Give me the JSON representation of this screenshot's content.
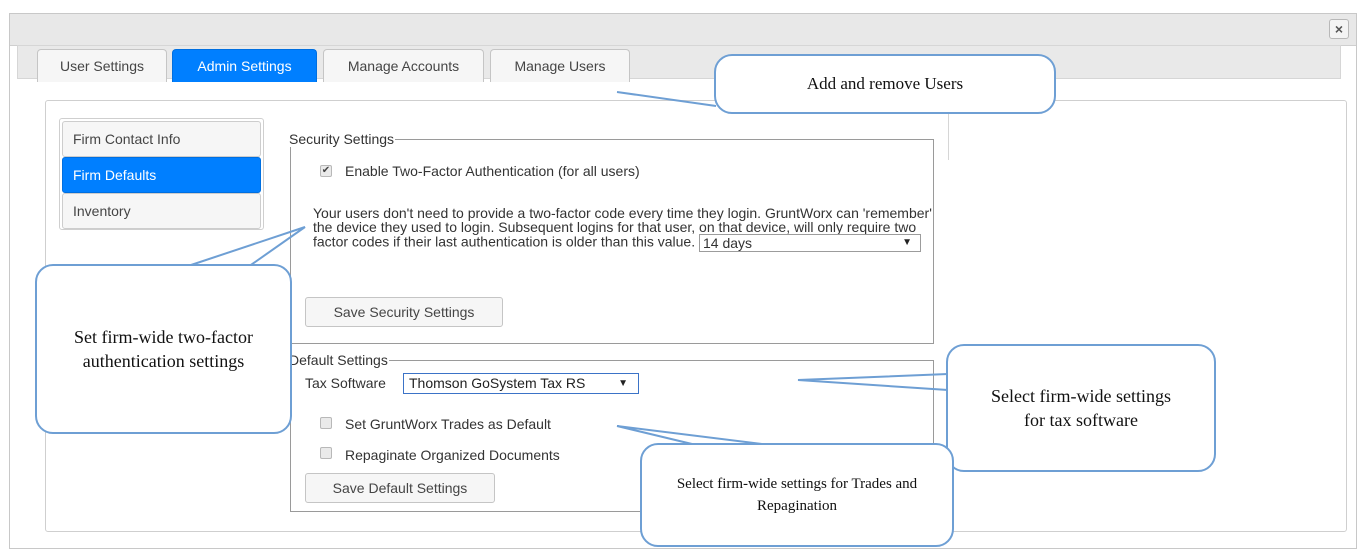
{
  "dialog": {
    "close_symbol": "×"
  },
  "tabs": [
    {
      "label": "User Settings"
    },
    {
      "label": "Admin Settings"
    },
    {
      "label": "Manage Accounts"
    },
    {
      "label": "Manage Users"
    }
  ],
  "sidebar": {
    "items": [
      {
        "label": "Firm Contact Info"
      },
      {
        "label": "Firm Defaults"
      },
      {
        "label": "Inventory"
      }
    ]
  },
  "security": {
    "legend": "Security Settings",
    "two_factor_label": "Enable Two-Factor Authentication (for all users)",
    "two_factor_checked": true,
    "description": "Your users don't need to provide a two-factor code every time they login. GruntWorx can 'remember' the device they used to login. Subsequent logins for that user, on that device, will only require two factor codes if their last authentication is older than this value.",
    "remember_value": "14 days",
    "save_label": "Save Security Settings"
  },
  "defaults": {
    "legend": "Default Settings",
    "tax_software_label": "Tax Software",
    "tax_software_value": "Thomson GoSystem Tax RS",
    "trades_label": "Set GruntWorx Trades as Default",
    "repaginate_label": "Repaginate Organized Documents",
    "save_label": "Save Default Settings"
  },
  "callouts": {
    "users": "Add and remove Users",
    "two_factor": "Set firm-wide two-factor authentication settings",
    "tax_software": "Select firm-wide settings for tax software",
    "trades": "Select firm-wide settings for Trades and Repagination"
  },
  "colors": {
    "accent": "#007fff",
    "callout_border": "#6e9fd4"
  }
}
